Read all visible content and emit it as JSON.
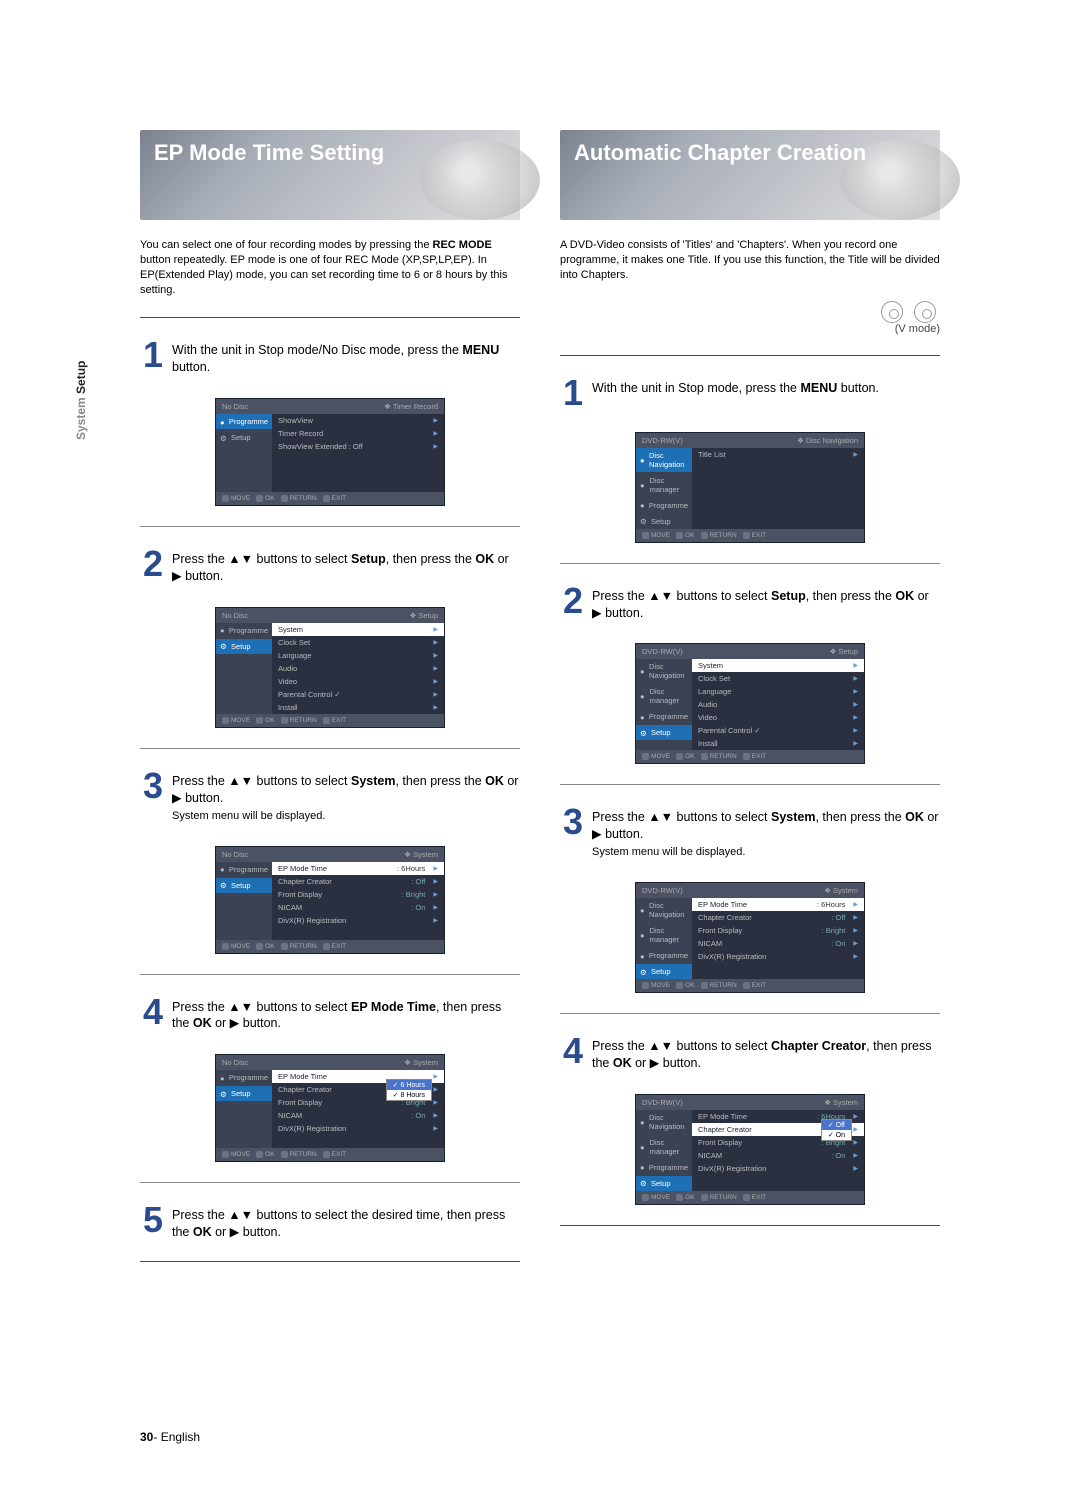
{
  "side_tab": {
    "prefix": "System",
    "main": "Setup"
  },
  "left": {
    "title": "EP Mode Time Setting",
    "intro_html": "You can select one of four recording modes by pressing the <b>REC MODE</b> button repeatedly. EP mode is one of four REC Mode (XP,SP,LP,EP). In EP(Extended Play) mode, you can set recording time to 6 or 8 hours by this setting.",
    "steps": [
      {
        "n": "1",
        "html": "With the unit in Stop mode/No Disc mode, press the <b>MENU</b> button."
      },
      {
        "n": "2",
        "html": "Press the ▲▼ buttons to select <b>Setup</b>, then press the <b>OK</b> or ▶ button."
      },
      {
        "n": "3",
        "html": "Press the ▲▼ buttons to select <b>System</b>, then press the <b>OK</b> or ▶ button.<br><small>System menu will be displayed.</small>"
      },
      {
        "n": "4",
        "html": "Press the ▲▼ buttons to select <b>EP Mode Time</b>, then press the <b>OK</b> or ▶ button."
      },
      {
        "n": "5",
        "html": "Press the ▲▼ buttons to select the desired time, then press the <b>OK</b> or ▶ button."
      }
    ]
  },
  "right": {
    "title": "Automatic Chapter Creation",
    "intro": "A DVD-Video consists of 'Titles' and 'Chapters'. When you record one programme, it makes one Title. If you use this function, the Title will be divided into Chapters.",
    "media_labels": [
      "DVD-RW",
      "DVD-R"
    ],
    "mode": "(V mode)",
    "steps": [
      {
        "n": "1",
        "html": "With the unit in Stop mode, press the <b>MENU</b> button."
      },
      {
        "n": "2",
        "html": "Press the ▲▼ buttons to select <b>Setup</b>, then press the <b>OK</b> or ▶ button."
      },
      {
        "n": "3",
        "html": "Press the ▲▼ buttons to select <b>System</b>, then press the <b>OK</b> or ▶ button.<br><small>System menu will be displayed.</small>"
      },
      {
        "n": "4",
        "html": "Press the ▲▼ buttons to select <b>Chapter Creator</b>, then press the <b>OK</b> or ▶ button."
      }
    ]
  },
  "osd": {
    "no_disc": "No Disc",
    "dvd_header": "DVD-RW(V)",
    "crumbs": {
      "timer": "Timer Record",
      "setup": "Setup",
      "system": "System",
      "discnav": "Disc Navigation"
    },
    "side_a": [
      {
        "icon": "●",
        "label": "Programme"
      },
      {
        "icon": "⚙",
        "label": "Setup"
      }
    ],
    "side_b": [
      {
        "icon": "●",
        "label": "Disc Navigation"
      },
      {
        "icon": "●",
        "label": "Disc manager"
      },
      {
        "icon": "●",
        "label": "Programme"
      },
      {
        "icon": "⚙",
        "label": "Setup"
      }
    ],
    "menu_timer": [
      {
        "label": "ShowView"
      },
      {
        "label": "Timer Record"
      },
      {
        "label": "ShowView Extended : Off"
      }
    ],
    "menu_discnav": [
      {
        "label": "Title List"
      }
    ],
    "menu_setup": [
      {
        "label": "System",
        "sel": true
      },
      {
        "label": "Clock Set"
      },
      {
        "label": "Language"
      },
      {
        "label": "Audio"
      },
      {
        "label": "Video"
      },
      {
        "label": "Parental Control ✓"
      },
      {
        "label": "Install"
      }
    ],
    "menu_system": [
      {
        "label": "EP Mode Time",
        "val": ": 6Hours",
        "sel": true
      },
      {
        "label": "Chapter Creator",
        "val": ": Off"
      },
      {
        "label": "Front Display",
        "val": ": Bright"
      },
      {
        "label": "NICAM",
        "val": ": On"
      },
      {
        "label": "DivX(R) Registration"
      }
    ],
    "menu_system_ep": [
      {
        "label": "EP Mode Time",
        "sel": true
      },
      {
        "label": "Chapter Creator",
        "val": ": Off"
      },
      {
        "label": "Front Display",
        "val": ": Bright"
      },
      {
        "label": "NICAM",
        "val": ": On"
      },
      {
        "label": "DivX(R) Registration"
      }
    ],
    "ep_options": [
      "6 Hours",
      "8 Hours"
    ],
    "menu_system_r3": [
      {
        "label": "EP Mode Time",
        "val": ": 6Hours",
        "sel": true
      },
      {
        "label": "Chapter Creator",
        "val": ": Off"
      },
      {
        "label": "Front Display",
        "val": ": Bright"
      },
      {
        "label": "NICAM",
        "val": ": On"
      },
      {
        "label": "DivX(R) Registration"
      }
    ],
    "menu_system_r4": [
      {
        "label": "EP Mode Time",
        "val": ": 6Hours"
      },
      {
        "label": "Chapter Creator",
        "sel": true
      },
      {
        "label": "Front Display",
        "val": ": Bright"
      },
      {
        "label": "NICAM",
        "val": ": On"
      },
      {
        "label": "DivX(R) Registration"
      }
    ],
    "cc_options": [
      "Off",
      "On"
    ],
    "footer": [
      {
        "icon": "◆",
        "label": "MOVE"
      },
      {
        "icon": "↵",
        "label": "OK"
      },
      {
        "icon": "↺",
        "label": "RETURN"
      },
      {
        "icon": "⊡",
        "label": "EXIT"
      }
    ]
  },
  "page_footer": {
    "num": "30",
    "sep": "-",
    "lang": "English"
  }
}
